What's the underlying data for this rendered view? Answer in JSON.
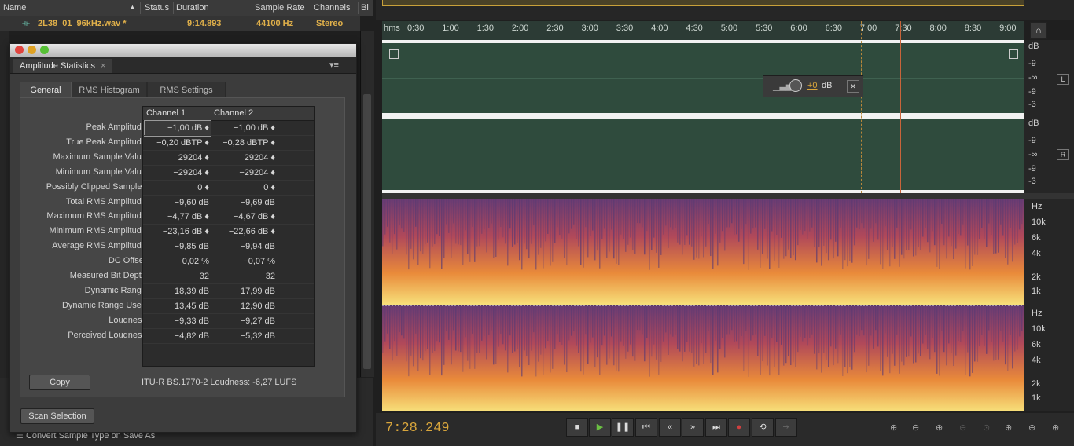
{
  "files_panel": {
    "columns": [
      "Name",
      "Status",
      "Duration",
      "Sample Rate",
      "Channels",
      "Bi"
    ],
    "file": {
      "name": "2L38_01_96kHz.wav *",
      "duration": "9:14.893",
      "sample_rate": "44100 Hz",
      "channels": "Stereo"
    }
  },
  "dialog": {
    "tab_title": "Amplitude Statistics",
    "tabs": [
      "General",
      "RMS Histogram",
      "RMS Settings"
    ],
    "columns": [
      "Channel 1",
      "Channel 2"
    ],
    "rows": [
      {
        "label": "Peak Amplitude:",
        "ch1": "−1,00 dB",
        "ch2": "−1,00 dB",
        "marker": true
      },
      {
        "label": "True Peak Amplitude:",
        "ch1": "−0,20 dBTP",
        "ch2": "−0,28 dBTP",
        "marker": true
      },
      {
        "label": "Maximum Sample Value:",
        "ch1": "29204",
        "ch2": "29204",
        "marker": true
      },
      {
        "label": "Minimum Sample Value:",
        "ch1": "−29204",
        "ch2": "−29204",
        "marker": true
      },
      {
        "label": "Possibly Clipped Samples:",
        "ch1": "0",
        "ch2": "0",
        "marker": true
      },
      {
        "label": "Total RMS Amplitude:",
        "ch1": "−9,60 dB",
        "ch2": "−9,69 dB",
        "marker": false
      },
      {
        "label": "Maximum RMS Amplitude:",
        "ch1": "−4,77 dB",
        "ch2": "−4,67 dB",
        "marker": true
      },
      {
        "label": "Minimum RMS Amplitude:",
        "ch1": "−23,16 dB",
        "ch2": "−22,66 dB",
        "marker": true
      },
      {
        "label": "Average RMS Amplitude:",
        "ch1": "−9,85 dB",
        "ch2": "−9,94 dB",
        "marker": false
      },
      {
        "label": "DC Offset:",
        "ch1": "0,02 %",
        "ch2": "−0,07 %",
        "marker": false
      },
      {
        "label": "Measured Bit Depth:",
        "ch1": "32",
        "ch2": "32",
        "marker": false
      },
      {
        "label": "Dynamic Range:",
        "ch1": "18,39 dB",
        "ch2": "17,99 dB",
        "marker": false
      },
      {
        "label": "Dynamic Range Used:",
        "ch1": "13,45 dB",
        "ch2": "12,90 dB",
        "marker": false
      },
      {
        "label": "Loudness:",
        "ch1": "−9,33 dB",
        "ch2": "−9,27 dB",
        "marker": false
      },
      {
        "label": "Perceived Loudness:",
        "ch1": "−4,82 dB",
        "ch2": "−5,32 dB",
        "marker": false
      }
    ],
    "copy_label": "Copy",
    "itu_text": "ITU-R BS.1770-2 Loudness: -6,27 LUFS",
    "scan_label": "Scan Selection"
  },
  "bottom_left": {
    "convert_label": "Convert Sample Type on Save As"
  },
  "editor": {
    "ruler_unit": "hms",
    "ruler_ticks": [
      "0:30",
      "1:00",
      "1:30",
      "2:00",
      "2:30",
      "3:00",
      "3:30",
      "4:00",
      "4:30",
      "5:00",
      "5:30",
      "6:00",
      "6:30",
      "7:00",
      "7:30",
      "8:00",
      "8:30",
      "9:00"
    ],
    "db_labels_top": [
      "dB",
      "-9",
      "-∞",
      "-9",
      "-3"
    ],
    "db_labels_bottom": [
      "dB",
      "-9",
      "-∞",
      "-9",
      "-3"
    ],
    "channel_left": "L",
    "channel_right": "R",
    "hud_gain": "+0",
    "hud_unit": "dB",
    "spec_labels": [
      "Hz",
      "10k",
      "6k",
      "4k",
      "2k",
      "1k"
    ],
    "current_time": "7:28.249"
  },
  "colors": {
    "accent": "#d9a63c",
    "waveform_bg": "#2f4b3d",
    "waveform": "#ffffff",
    "playhead": "#c8643a"
  }
}
